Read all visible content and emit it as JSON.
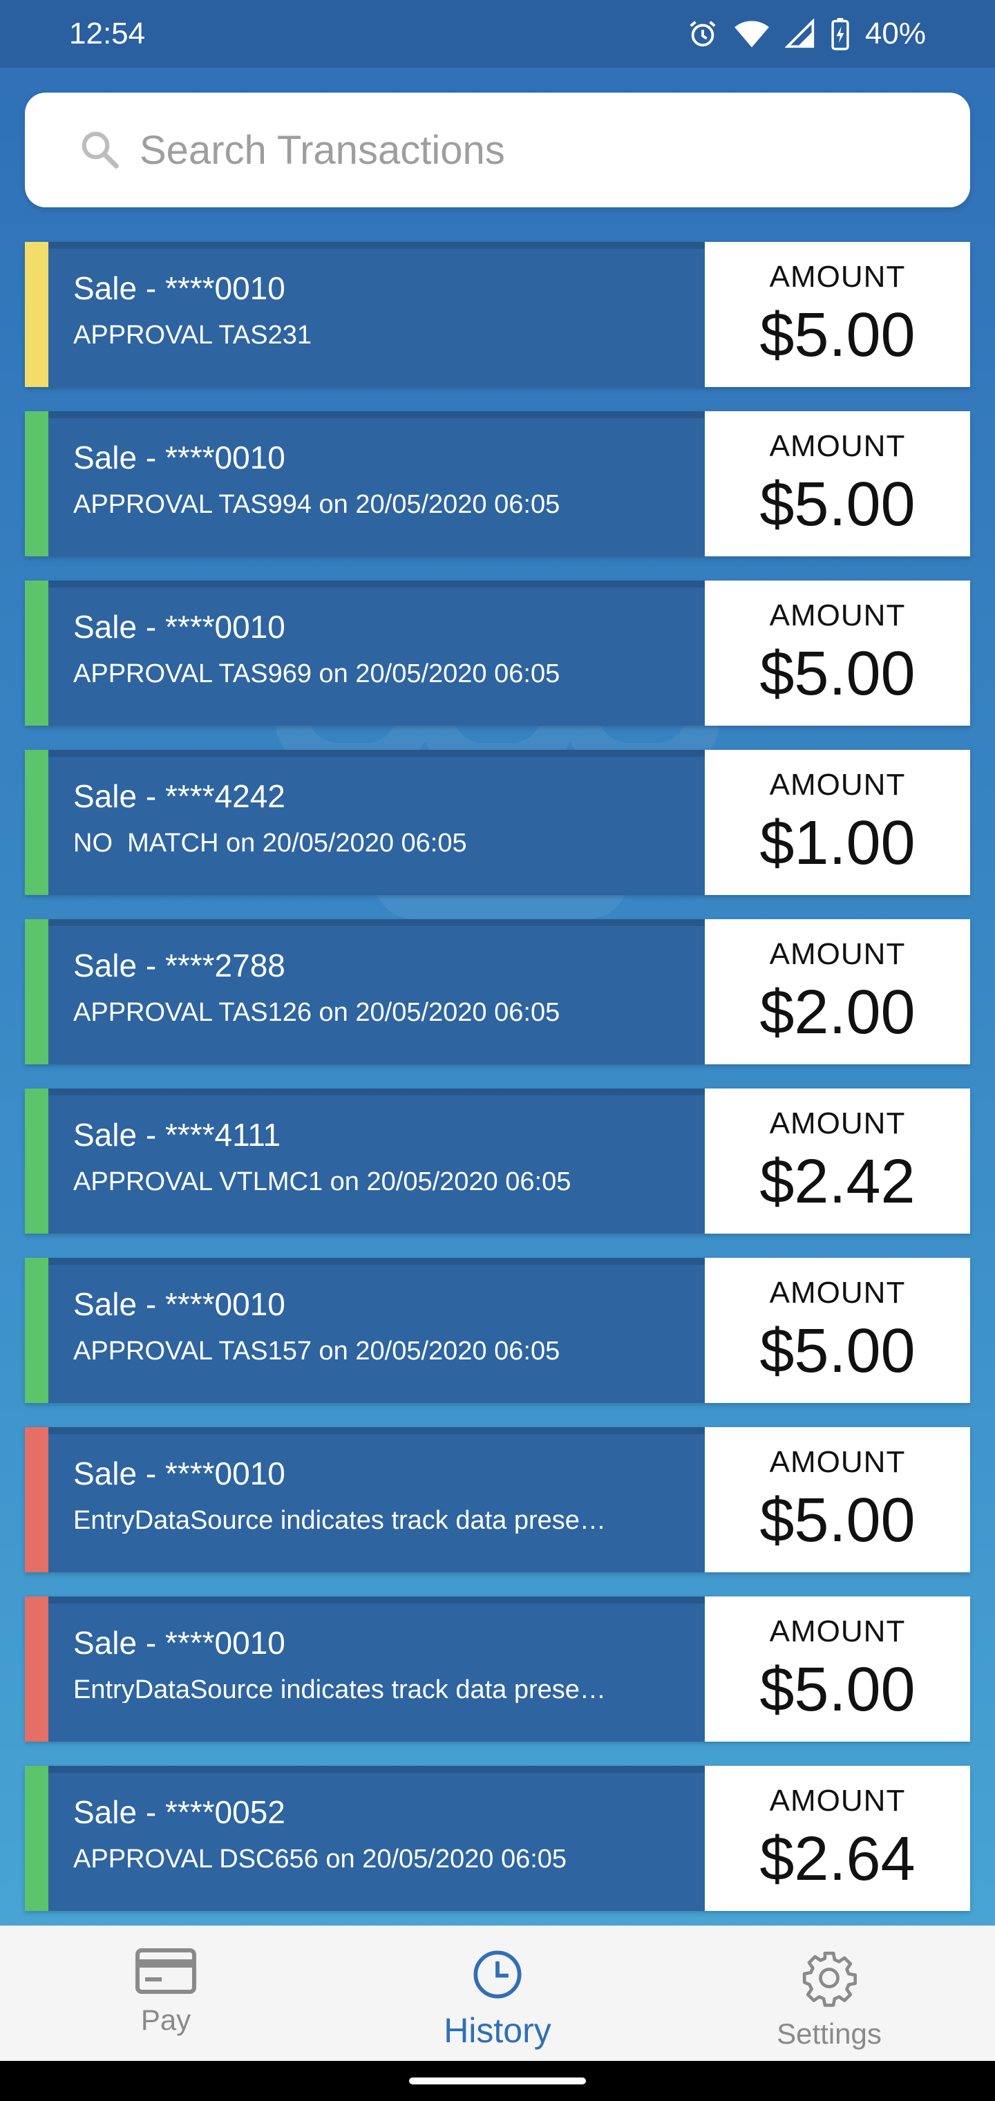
{
  "status_bar": {
    "time": "12:54",
    "battery": "40%"
  },
  "search": {
    "placeholder": "Search Transactions"
  },
  "colors": {
    "approved": "#5cc46a",
    "pending": "#f3dd6a",
    "declined": "#e56f64"
  },
  "transactions": [
    {
      "title": "Sale - ****0010",
      "subtitle": "APPROVAL TAS231",
      "amount_label": "AMOUNT",
      "amount": "$5.00",
      "status": "pending"
    },
    {
      "title": "Sale - ****0010",
      "subtitle": "APPROVAL TAS994 on 20/05/2020 06:05",
      "amount_label": "AMOUNT",
      "amount": "$5.00",
      "status": "approved"
    },
    {
      "title": "Sale - ****0010",
      "subtitle": "APPROVAL TAS969 on 20/05/2020 06:05",
      "amount_label": "AMOUNT",
      "amount": "$5.00",
      "status": "approved"
    },
    {
      "title": "Sale - ****4242",
      "subtitle": "NO  MATCH on 20/05/2020 06:05",
      "amount_label": "AMOUNT",
      "amount": "$1.00",
      "status": "approved"
    },
    {
      "title": "Sale - ****2788",
      "subtitle": "APPROVAL TAS126 on 20/05/2020 06:05",
      "amount_label": "AMOUNT",
      "amount": "$2.00",
      "status": "approved"
    },
    {
      "title": "Sale - ****4111",
      "subtitle": "APPROVAL VTLMC1 on 20/05/2020 06:05",
      "amount_label": "AMOUNT",
      "amount": "$2.42",
      "status": "approved"
    },
    {
      "title": "Sale - ****0010",
      "subtitle": "APPROVAL TAS157 on 20/05/2020 06:05",
      "amount_label": "AMOUNT",
      "amount": "$5.00",
      "status": "approved"
    },
    {
      "title": "Sale - ****0010",
      "subtitle": "EntryDataSource indicates track data prese…",
      "amount_label": "AMOUNT",
      "amount": "$5.00",
      "status": "declined"
    },
    {
      "title": "Sale - ****0010",
      "subtitle": "EntryDataSource indicates track data prese…",
      "amount_label": "AMOUNT",
      "amount": "$5.00",
      "status": "declined"
    },
    {
      "title": "Sale - ****0052",
      "subtitle": "APPROVAL DSC656 on 20/05/2020 06:05",
      "amount_label": "AMOUNT",
      "amount": "$2.64",
      "status": "approved"
    }
  ],
  "bottom_nav": {
    "items": [
      {
        "label": "Pay",
        "icon": "credit-card-icon",
        "active": false
      },
      {
        "label": "History",
        "icon": "clock-icon",
        "active": true
      },
      {
        "label": "Settings",
        "icon": "gear-icon",
        "active": false
      }
    ]
  }
}
